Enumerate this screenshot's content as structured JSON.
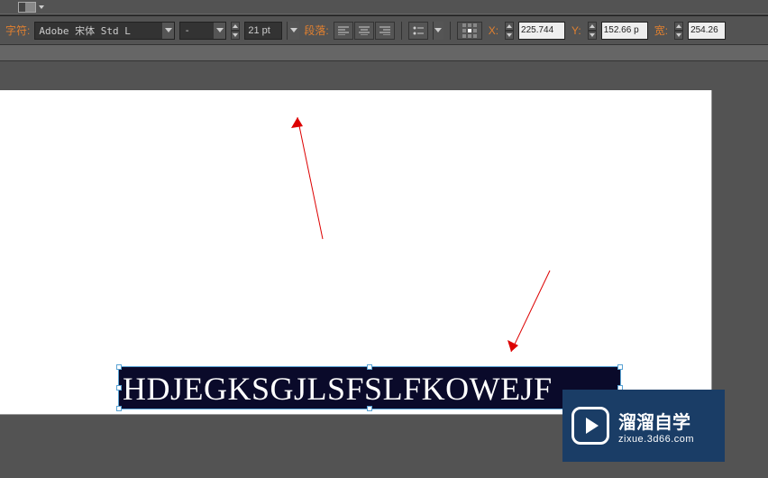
{
  "topbar": {
    "char_label": "字符:",
    "font_family": "Adobe 宋体 Std L",
    "font_style": "-",
    "font_size": "21 pt",
    "paragraph_label": "段落:"
  },
  "coords": {
    "x_label": "X:",
    "x_value": "225.744",
    "y_label": "Y:",
    "y_value": "152.66 p",
    "w_label": "宽:",
    "w_value": "254.26"
  },
  "canvas": {
    "text": "HDJEGKSGJLSFSLFKOWEJF"
  },
  "watermark": {
    "title": "溜溜自学",
    "subtitle": "zixue.3d66.com"
  }
}
